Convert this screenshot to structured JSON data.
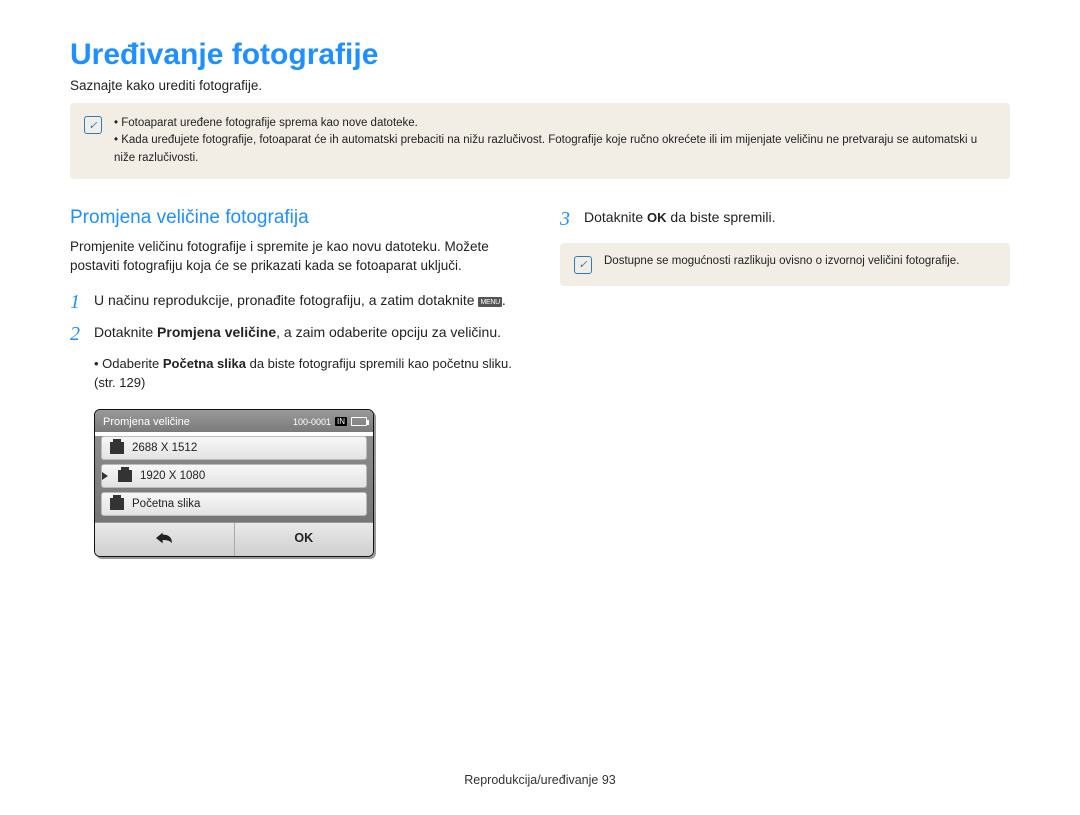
{
  "title": "Uređivanje fotografije",
  "subtitle": "Saznajte kako urediti fotografije.",
  "top_note": {
    "items": [
      "Fotoaparat uređene fotografije sprema kao nove datoteke.",
      "Kada uređujete fotografije, fotoaparat će ih automatski prebaciti na nižu razlučivost. Fotografije koje ručno okrećete ili im mijenjate veličinu ne pretvaraju se automatski u niže razlučivosti."
    ]
  },
  "left": {
    "heading": "Promjena veličine fotografija",
    "intro": "Promjenite veličinu fotografije i spremite je kao novu datoteku. Možete postaviti fotografiju koja će se prikazati kada se fotoaparat uključi.",
    "step1_a": "U načinu reprodukcije, pronađite fotografiju, a zatim dotaknite ",
    "step1_b": ".",
    "menu_chip": "MENU",
    "step2_a": "Dotaknite ",
    "step2_bold": "Promjena veličine",
    "step2_b": ", a zaim odaberite opciju za veličinu.",
    "sub_a": "Odaberite ",
    "sub_bold": "Početna slika",
    "sub_b": " da biste fotografiju spremili kao početnu sliku. (str. 129)"
  },
  "camera": {
    "title": "Promjena veličine",
    "counter": "100-0001",
    "in_chip": "IN",
    "items": [
      {
        "label": "2688 X 1512",
        "selected": false
      },
      {
        "label": "1920 X 1080",
        "selected": true
      },
      {
        "label": "Početna slika",
        "selected": false
      }
    ],
    "ok": "OK"
  },
  "right": {
    "step3_a": "Dotaknite ",
    "step3_ok": "OK",
    "step3_b": " da biste spremili.",
    "note": "Dostupne se mogućnosti razlikuju ovisno o izvornoj veličini fotografije."
  },
  "footer_a": "Reprodukcija/uređivanje  ",
  "footer_b": "93"
}
